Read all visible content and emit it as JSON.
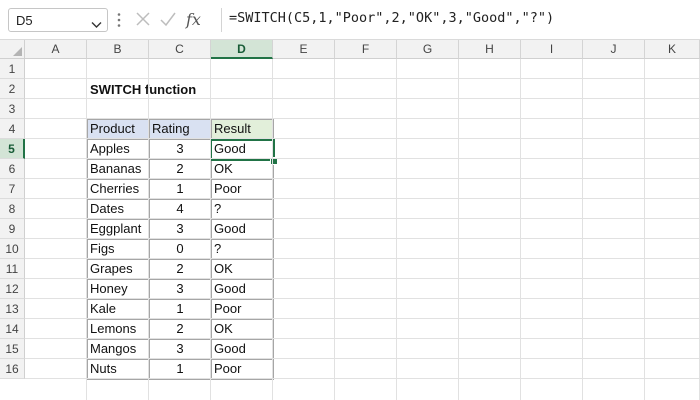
{
  "formula_bar": {
    "name_box": "D5",
    "formula": "=SWITCH(C5,1,\"Poor\",2,\"OK\",3,\"Good\",\"?\")"
  },
  "sheet": {
    "columns": [
      "A",
      "B",
      "C",
      "D",
      "E",
      "F",
      "G",
      "H",
      "I",
      "J",
      "K"
    ],
    "rows": [
      "1",
      "2",
      "3",
      "4",
      "5",
      "6",
      "7",
      "8",
      "9",
      "10",
      "11",
      "12",
      "13",
      "14",
      "15",
      "16"
    ],
    "selected_column": "D",
    "selected_row": "5",
    "title": "SWITCH function",
    "table": {
      "headers": [
        "Product",
        "Rating",
        "Result"
      ],
      "rows": [
        [
          "Apples",
          "3",
          "Good"
        ],
        [
          "Bananas",
          "2",
          "OK"
        ],
        [
          "Cherries",
          "1",
          "Poor"
        ],
        [
          "Dates",
          "4",
          "?"
        ],
        [
          "Eggplant",
          "3",
          "Good"
        ],
        [
          "Figs",
          "0",
          "?"
        ],
        [
          "Grapes",
          "2",
          "OK"
        ],
        [
          "Honey",
          "3",
          "Good"
        ],
        [
          "Kale",
          "1",
          "Poor"
        ],
        [
          "Lemons",
          "2",
          "OK"
        ],
        [
          "Mangos",
          "3",
          "Good"
        ],
        [
          "Nuts",
          "1",
          "Poor"
        ]
      ]
    }
  },
  "colors": {
    "header_product_rating": "#d9e1f2",
    "header_result": "#e2efda",
    "selection_green": "#217346"
  },
  "icons": [
    "chevron-down-icon",
    "more-vert-icon",
    "cancel-icon",
    "enter-icon",
    "fx-icon"
  ]
}
